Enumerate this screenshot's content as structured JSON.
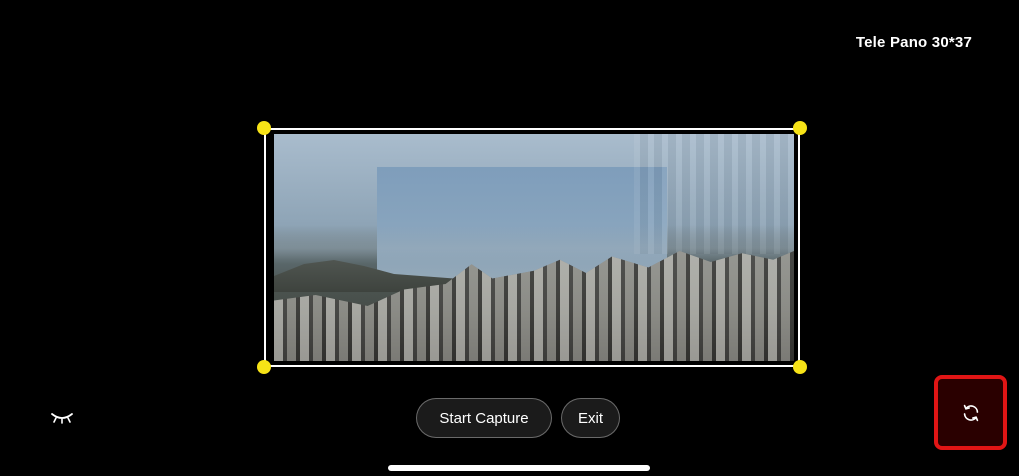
{
  "header": {
    "mode_label": "Tele Pano 30*37"
  },
  "preview": {
    "image": "panorama-cityscape"
  },
  "controls": {
    "start_capture_label": "Start Capture",
    "exit_label": "Exit",
    "visibility_icon": "eye-closed-icon",
    "rotate_icon": "rotate-icon"
  },
  "colors": {
    "handle": "#f7e317",
    "highlight": "#e11515",
    "background": "#000000"
  }
}
